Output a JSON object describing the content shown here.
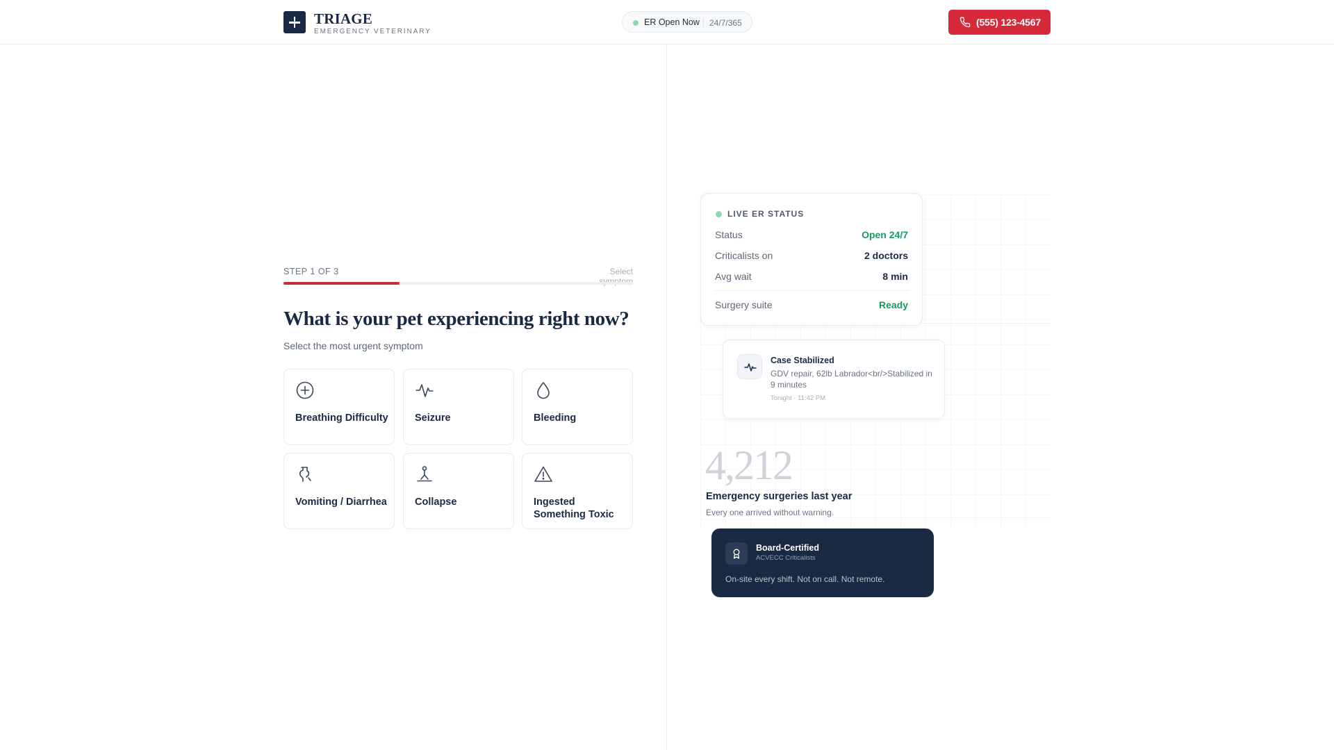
{
  "header": {
    "brand_title": "TRIAGE",
    "brand_subtitle": "EMERGENCY VETERINARY",
    "er_status": "ER Open Now",
    "er_hours": "24/7/365",
    "phone_label": "(555) 123-4567"
  },
  "stepper": {
    "step_label": "STEP 1 OF 3",
    "step_hint": "Select symptom",
    "progress_fraction": 0.333
  },
  "question": {
    "title": "What is your pet experiencing right now?",
    "subtitle": "Select the most urgent symptom"
  },
  "symptoms": [
    {
      "label": "Breathing Difficulty",
      "icon": "plus-circle-icon"
    },
    {
      "label": "Seizure",
      "icon": "pulse-icon"
    },
    {
      "label": "Bleeding",
      "icon": "droplet-icon"
    },
    {
      "label": "Vomiting / Diarrhea",
      "icon": "stomach-icon"
    },
    {
      "label": "Collapse",
      "icon": "collapse-icon"
    },
    {
      "label": "Ingested Something Toxic",
      "icon": "warning-triangle-icon"
    }
  ],
  "status_card": {
    "title": "LIVE ER STATUS",
    "rows": [
      {
        "label": "Status",
        "value": "Open 24/7"
      },
      {
        "label": "Criticalists on",
        "value": "2 doctors"
      },
      {
        "label": "Avg wait",
        "value": "8 min"
      },
      {
        "label": "Surgery suite",
        "value": "Ready"
      }
    ]
  },
  "case_card": {
    "title": "Case Stabilized",
    "description": "GDV repair, 62lb Labrador<br/>Stabilized in 9 minutes",
    "time": "Tonight · 11:42 PM"
  },
  "stat": {
    "number": "4,212",
    "label": "Emergency surgeries last year",
    "sub": "Every one arrived without warning."
  },
  "cert_card": {
    "title": "Board-Certified",
    "subtitle": "ACVECC Criticalists",
    "description": "On-site every shift. Not on call. Not remote."
  },
  "colors": {
    "navy": "#1b2a44",
    "accent_red": "#d62a3a",
    "status_green": "#1a9a62",
    "live_dot": "#8fd6b3"
  }
}
